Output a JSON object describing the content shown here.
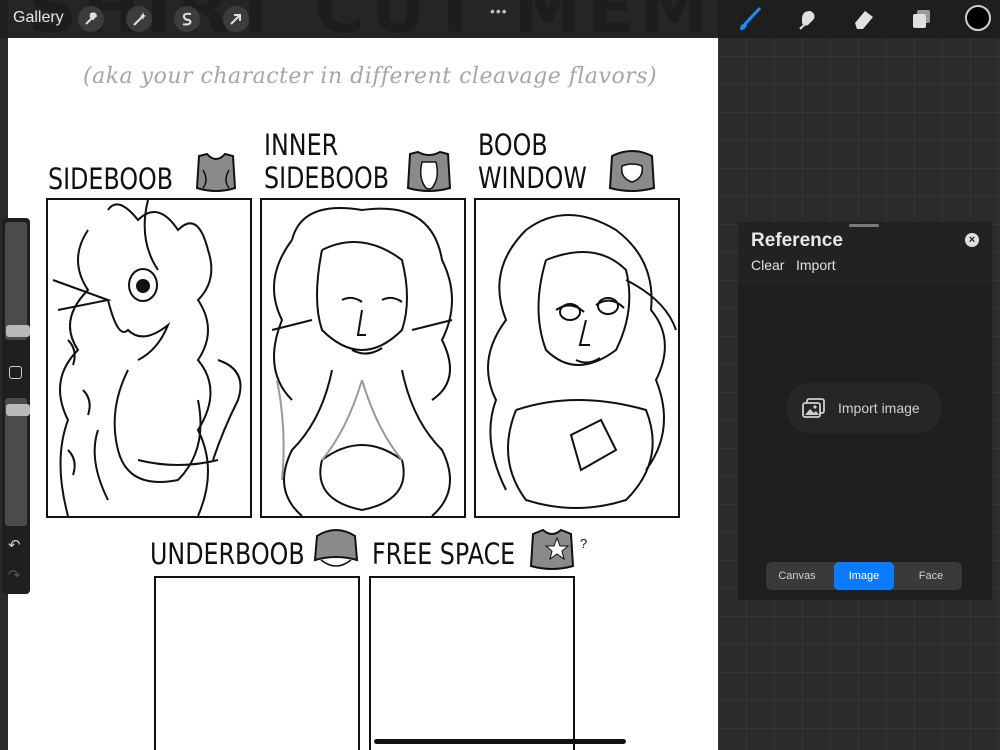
{
  "app": {
    "gallery_label": "Gallery",
    "menu_dots": "•••"
  },
  "toolbar_left": [
    {
      "name": "actions-wrench",
      "icon": "wrench-icon"
    },
    {
      "name": "adjustments",
      "icon": "magic-wand-icon"
    },
    {
      "name": "selection",
      "icon": "selection-s-icon"
    },
    {
      "name": "transform",
      "icon": "arrow-icon"
    }
  ],
  "toolbar_right": [
    {
      "name": "brush",
      "icon": "brush-icon",
      "active": true
    },
    {
      "name": "smudge",
      "icon": "smudge-icon"
    },
    {
      "name": "eraser",
      "icon": "eraser-icon"
    },
    {
      "name": "layers",
      "icon": "layers-icon"
    }
  ],
  "color": {
    "current": "#000000",
    "accent": "#0a7aff"
  },
  "canvas": {
    "title": "SHIRT CUT MEME",
    "subtitle": "(aka your character in different cleavage flavors)",
    "panels": [
      {
        "label_lines": [
          "SIDEBOOB"
        ],
        "icon": "shirt-sideboob-icon"
      },
      {
        "label_lines": [
          "INNER",
          "SIDEBOOB"
        ],
        "icon": "shirt-inner-sideboob-icon"
      },
      {
        "label_lines": [
          "BOOB",
          "WINDOW"
        ],
        "icon": "shirt-boob-window-icon"
      },
      {
        "label_lines": [
          "UNDERBOOB"
        ],
        "icon": "shirt-underboob-icon"
      },
      {
        "label_lines": [
          "FREE SPACE"
        ],
        "icon": "shirt-free-space-icon",
        "mark": "?"
      }
    ]
  },
  "sidebar": {
    "brush_size": 0.62,
    "opacity": 0.07,
    "undo_icon": "↶",
    "redo_icon": "↷"
  },
  "reference": {
    "title": "Reference",
    "clear_label": "Clear",
    "import_label": "Import",
    "import_image_label": "Import image",
    "close_icon": "×",
    "segments": [
      {
        "label": "Canvas",
        "active": false
      },
      {
        "label": "Image",
        "active": true
      },
      {
        "label": "Face",
        "active": false
      }
    ]
  }
}
